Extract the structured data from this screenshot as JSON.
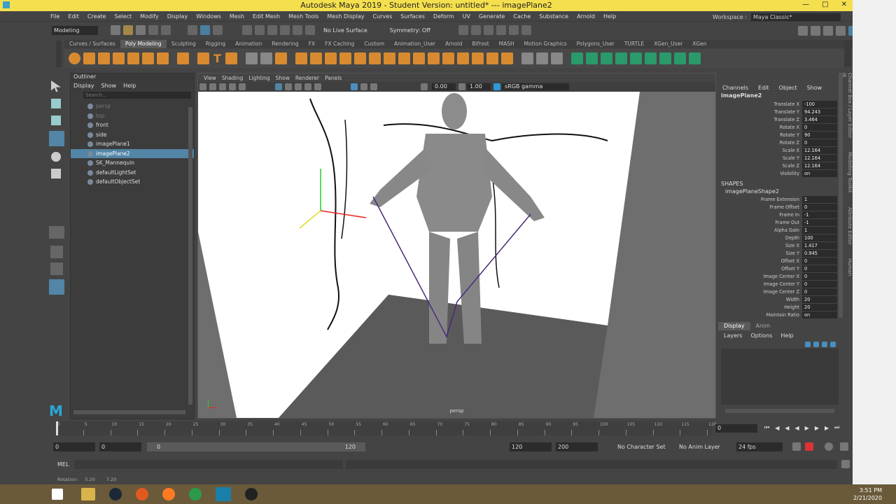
{
  "window": {
    "title": "Autodesk Maya 2019 - Student Version: untitled*   ---   imagePlane2"
  },
  "menu": [
    "File",
    "Edit",
    "Create",
    "Select",
    "Modify",
    "Display",
    "Windows",
    "Mesh",
    "Edit Mesh",
    "Mesh Tools",
    "Mesh Display",
    "Curves",
    "Surfaces",
    "Deform",
    "UV",
    "Generate",
    "Cache",
    "Substance",
    "Arnold",
    "Help"
  ],
  "workspace": {
    "label": "Workspace :",
    "value": "Maya Classic*"
  },
  "status": {
    "mode": "Modeling",
    "live": "No Live Surface",
    "symmetry": "Symmetry: Off"
  },
  "shelf_tabs": [
    "Curves / Surfaces",
    "Poly Modeling",
    "Sculpting",
    "Rigging",
    "Animation",
    "Rendering",
    "FX",
    "FX Caching",
    "Custom",
    "Animation_User",
    "Arnold",
    "Bifrost",
    "MASH",
    "Motion Graphics",
    "Polygons_User",
    "TURTLE",
    "XGen_User",
    "XGen"
  ],
  "shelf_active": "Poly Modeling",
  "outliner": {
    "title": "Outliner",
    "menu": [
      "Display",
      "Show",
      "Help"
    ],
    "search_placeholder": "Search...",
    "items": [
      {
        "label": "persp",
        "state": "dim"
      },
      {
        "label": "top",
        "state": "dim"
      },
      {
        "label": "front",
        "state": "normal"
      },
      {
        "label": "side",
        "state": "normal"
      },
      {
        "label": "imagePlane1",
        "state": "normal"
      },
      {
        "label": "imagePlane2",
        "state": "selected"
      },
      {
        "label": "SK_Mannequin",
        "state": "normal"
      },
      {
        "label": "defaultLightSet",
        "state": "normal"
      },
      {
        "label": "defaultObjectSet",
        "state": "normal"
      }
    ]
  },
  "viewport": {
    "menu": [
      "View",
      "Shading",
      "Lighting",
      "Show",
      "Renderer",
      "Panels"
    ],
    "field1": "0.00",
    "field2": "1.00",
    "colorspace": "sRGB gamma",
    "camera": "persp"
  },
  "channelbox": {
    "menu": [
      "Channels",
      "Edit",
      "Object",
      "Show"
    ],
    "object": "imagePlane2",
    "channels": [
      {
        "name": "Translate X",
        "value": "-100"
      },
      {
        "name": "Translate Y",
        "value": "94.243"
      },
      {
        "name": "Translate Z",
        "value": "3.464"
      },
      {
        "name": "Rotate X",
        "value": "0"
      },
      {
        "name": "Rotate Y",
        "value": "90"
      },
      {
        "name": "Rotate Z",
        "value": "0"
      },
      {
        "name": "Scale X",
        "value": "12.164"
      },
      {
        "name": "Scale Y",
        "value": "12.164"
      },
      {
        "name": "Scale Z",
        "value": "12.164"
      },
      {
        "name": "Visibility",
        "value": "on"
      }
    ],
    "shapes_label": "SHAPES",
    "shape": "imagePlaneShape2",
    "shape_attrs": [
      {
        "name": "Frame Extension",
        "value": "1"
      },
      {
        "name": "Frame Offset",
        "value": "0"
      },
      {
        "name": "Frame In",
        "value": "-1"
      },
      {
        "name": "Frame Out",
        "value": "-1"
      },
      {
        "name": "Alpha Gain",
        "value": "1"
      },
      {
        "name": "Depth",
        "value": "100"
      },
      {
        "name": "Size X",
        "value": "1.417"
      },
      {
        "name": "Size Y",
        "value": "0.945"
      },
      {
        "name": "Offset X",
        "value": "0"
      },
      {
        "name": "Offset Y",
        "value": "0"
      },
      {
        "name": "Image Center X",
        "value": "0"
      },
      {
        "name": "Image Center Y",
        "value": "0"
      },
      {
        "name": "Image Center Z",
        "value": "0"
      },
      {
        "name": "Width",
        "value": "20"
      },
      {
        "name": "Height",
        "value": "20"
      },
      {
        "name": "Maintain Ratio",
        "value": "on"
      }
    ],
    "side_tabs": [
      "Channel Box / Layer Editor",
      "Modelling Toolkit",
      "Attribute Editor",
      "Human IK"
    ]
  },
  "layer_editor": {
    "tabs": [
      "Display",
      "Anim"
    ],
    "menu": [
      "Layers",
      "Options",
      "Help"
    ]
  },
  "timeline": {
    "ticks": [
      "0",
      "5",
      "10",
      "15",
      "20",
      "25",
      "30",
      "35",
      "40",
      "45",
      "50",
      "55",
      "60",
      "65",
      "70",
      "75",
      "80",
      "85",
      "90",
      "95",
      "100",
      "105",
      "110",
      "115",
      "120"
    ],
    "current": "0",
    "range_start": "0",
    "range_start2": "0",
    "range_inner_start": "0",
    "range_inner_end": "120",
    "range_end": "120",
    "range_end2": "200",
    "char_set": "No Character Set",
    "anim_layer": "No Anim Layer",
    "fps": "24 fps"
  },
  "mel": {
    "label": "MEL"
  },
  "helpline": {
    "label": "Rotation:",
    "x": "5.20",
    "y": "7.20"
  },
  "taskbar": {
    "time": "3:51 PM",
    "date": "2/21/2020"
  },
  "colors": {
    "title": "#f4df4e",
    "selected": "#5285a6",
    "panel": "#444444",
    "imageplane": "#ffffff",
    "floor": "#555555"
  }
}
